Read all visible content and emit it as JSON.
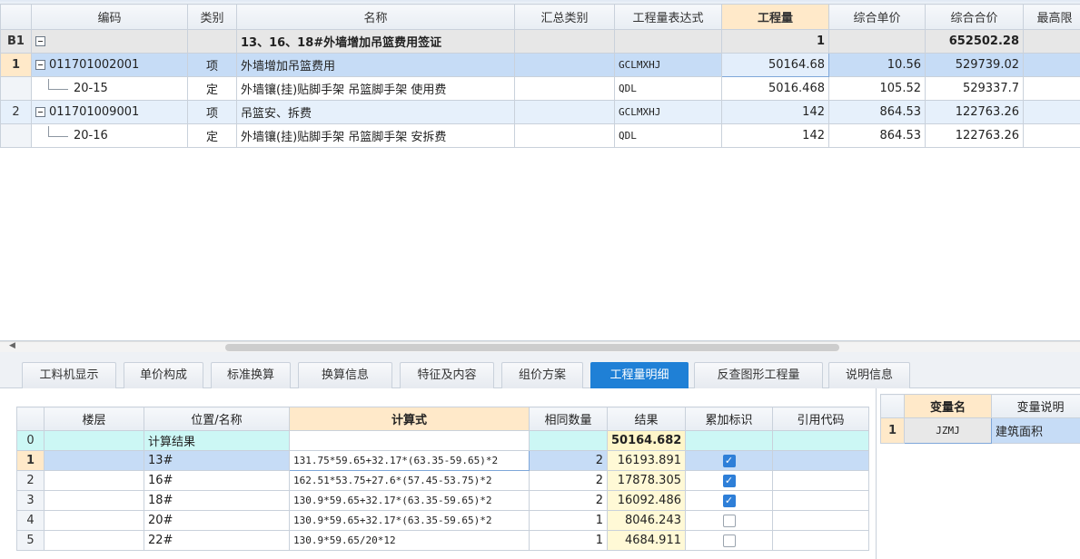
{
  "main_grid": {
    "columns": [
      "编码",
      "类别",
      "名称",
      "汇总类别",
      "工程量表达式",
      "工程量",
      "综合单价",
      "综合合价",
      "最高限"
    ],
    "group_row": {
      "num": "B1",
      "name": "13、16、18#外墙增加吊篮费用签证",
      "quantity": "1",
      "total": "652502.28"
    },
    "rows": [
      {
        "num": "1",
        "code": "011701002001",
        "type": "项",
        "name": "外墙增加吊篮费用",
        "expr": "GCLMXHJ",
        "qty": "50164.68",
        "price": "10.56",
        "total": "529739.02"
      },
      {
        "num": "",
        "code": "20-15",
        "type": "定",
        "name": "外墙镶(挂)贴脚手架 吊篮脚手架 使用费",
        "expr": "QDL",
        "qty": "5016.468",
        "price": "105.52",
        "total": "529337.7"
      },
      {
        "num": "2",
        "code": "011701009001",
        "type": "项",
        "name": "吊篮安、拆费",
        "expr": "GCLMXHJ",
        "qty": "142",
        "price": "864.53",
        "total": "122763.26"
      },
      {
        "num": "",
        "code": "20-16",
        "type": "定",
        "name": "外墙镶(挂)贴脚手架 吊篮脚手架 安拆费",
        "expr": "QDL",
        "qty": "142",
        "price": "864.53",
        "total": "122763.26"
      }
    ]
  },
  "tabs": [
    "工料机显示",
    "单价构成",
    "标准换算",
    "换算信息",
    "特征及内容",
    "组价方案",
    "工程量明细",
    "反查图形工程量",
    "说明信息"
  ],
  "active_tab": "工程量明细",
  "detail_grid": {
    "columns": [
      "楼层",
      "位置/名称",
      "计算式",
      "相同数量",
      "结果",
      "累加标识",
      "引用代码"
    ],
    "summary_row": {
      "num": "0",
      "name": "计算结果",
      "result": "50164.682"
    },
    "rows": [
      {
        "num": "1",
        "name": "13#",
        "formula": "131.75*59.65+32.17*(63.35-59.65)*2",
        "count": "2",
        "result": "16193.891",
        "checked": true
      },
      {
        "num": "2",
        "name": "16#",
        "formula": "162.51*53.75+27.6*(57.45-53.75)*2",
        "count": "2",
        "result": "17878.305",
        "checked": true
      },
      {
        "num": "3",
        "name": "18#",
        "formula": "130.9*59.65+32.17*(63.35-59.65)*2",
        "count": "2",
        "result": "16092.486",
        "checked": true
      },
      {
        "num": "4",
        "name": "20#",
        "formula": "130.9*59.65+32.17*(63.35-59.65)*2",
        "count": "1",
        "result": "8046.243",
        "checked": false
      },
      {
        "num": "5",
        "name": "22#",
        "formula": "130.9*59.65/20*12",
        "count": "1",
        "result": "4684.911",
        "checked": false
      }
    ]
  },
  "variable_panel": {
    "columns": [
      "变量名",
      "变量说明"
    ],
    "rows": [
      {
        "num": "1",
        "name": "JZMJ",
        "desc": "建筑面积"
      }
    ]
  },
  "colors": {
    "accent": "#1f80d6",
    "selected_row": "#c6dcf6",
    "header_highlight": "#ffe9c9",
    "check_on": "#2e7fd8"
  }
}
